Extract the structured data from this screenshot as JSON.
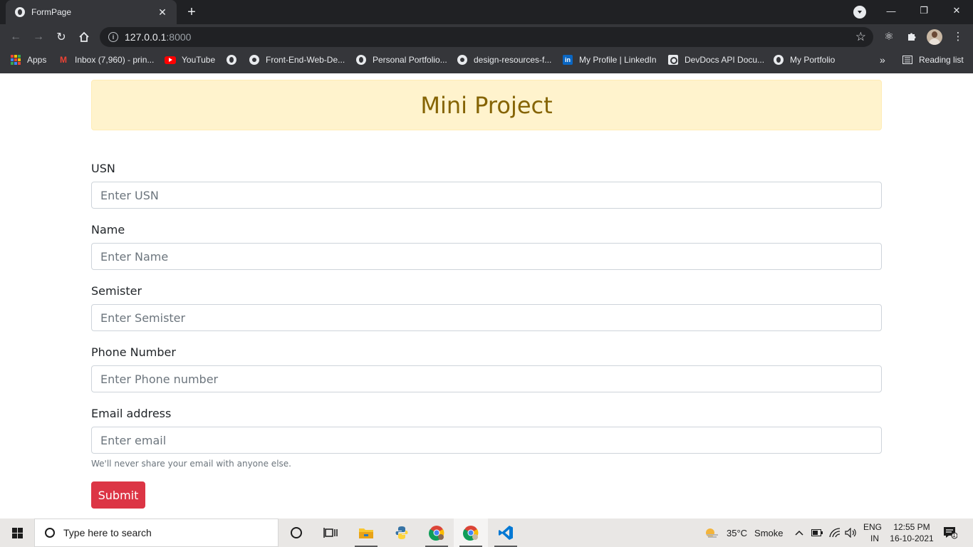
{
  "browser": {
    "tab_title": "FormPage",
    "url_host": "127.0.0.1",
    "url_port": ":8000",
    "bookmarks": [
      {
        "label": "Apps"
      },
      {
        "label": "Inbox (7,960) - prin..."
      },
      {
        "label": "YouTube"
      },
      {
        "label": ""
      },
      {
        "label": "Front-End-Web-De..."
      },
      {
        "label": "Personal Portfolio..."
      },
      {
        "label": "design-resources-f..."
      },
      {
        "label": "My Profile | LinkedIn"
      },
      {
        "label": "DevDocs API Docu..."
      },
      {
        "label": "My Portfolio"
      }
    ],
    "overflow_label": "»",
    "reading_list": "Reading list"
  },
  "page": {
    "banner_title": "Mini Project",
    "fields": [
      {
        "label": "USN",
        "placeholder": "Enter USN"
      },
      {
        "label": "Name",
        "placeholder": "Enter Name"
      },
      {
        "label": "Semister",
        "placeholder": "Enter Semister"
      },
      {
        "label": "Phone Number",
        "placeholder": "Enter Phone number"
      },
      {
        "label": "Email address",
        "placeholder": "Enter email"
      }
    ],
    "email_help": "We'll never share your email with anyone else.",
    "submit_label": "Submit"
  },
  "taskbar": {
    "search_placeholder": "Type here to search",
    "weather_temp": "35°C",
    "weather_text": "Smoke",
    "lang_top": "ENG",
    "lang_bottom": "IN",
    "time": "12:55 PM",
    "date": "16-10-2021",
    "notification_count": "1"
  }
}
